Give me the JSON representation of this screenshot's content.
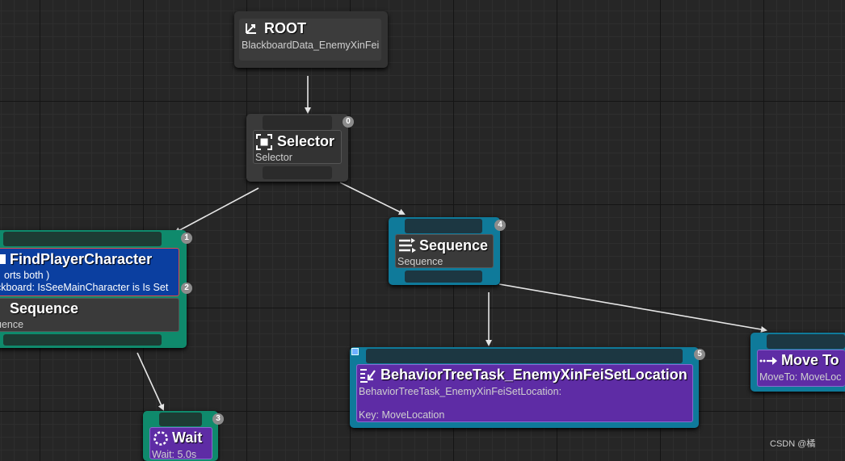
{
  "nodes": {
    "root": {
      "title": "ROOT",
      "subtitle": "BlackboardData_EnemyXinFei"
    },
    "selector": {
      "title": "Selector",
      "subtitle": "Selector",
      "index": "0"
    },
    "find_sequence": {
      "index": "1",
      "decorator_title": "FindPlayerCharacter",
      "decorator_line1": "orts both )",
      "decorator_line2": "ckboard: IsSeeMainCharacter is Is Set",
      "decorator_index": "2",
      "title": "Sequence",
      "subtitle": "uence"
    },
    "sequence4": {
      "title": "Sequence",
      "subtitle": "Sequence",
      "index": "4"
    },
    "task5": {
      "title": "BehaviorTreeTask_EnemyXinFeiSetLocation",
      "line1": "BehaviorTreeTask_EnemyXinFeiSetLocation:",
      "line2": "Key: MoveLocation",
      "index": "5"
    },
    "moveto": {
      "title": "Move To",
      "subtitle": "MoveTo: MoveLoc"
    },
    "wait": {
      "title": "Wait",
      "subtitle": "Wait: 5.0s",
      "index": "3"
    }
  },
  "watermark": "CSDN @橘",
  "colors": {
    "composite": "#3a3a3a",
    "active_green": "#0f8a6c",
    "teal": "#0f7a9a",
    "decorator_blue": "#0b3fa0",
    "task_purple": "#5e2ca5",
    "wire": "#e6e6e6"
  }
}
